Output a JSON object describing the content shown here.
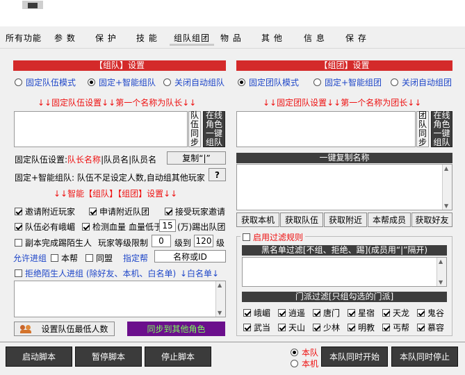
{
  "tabs": [
    "所有功能",
    "参 数",
    "保 护",
    "技 能",
    "组队组团",
    "物 品",
    "其 他",
    "信 息",
    "保 存"
  ],
  "left": {
    "header": "【组队】设置",
    "radios": [
      "固定队伍模式",
      "固定+智能组队",
      "关闭自动组队"
    ],
    "fixed_hint": "↓↓固定队伍设置↓↓第一个名称为队长↓↓",
    "side_btn": "队伍同步",
    "online_btn": "在线角色一键组队",
    "fixed_label": "固定队伍设置:",
    "fixed_fmt_red": "队长名称",
    "fixed_fmt_rest": "|队员名|队员名",
    "copy_btn": "复制“|”",
    "smart_label": "固定+智能组队: 队伍不足设定人数,自动组其他玩家",
    "help_btn": "?",
    "smart_hint": "↓↓智能【组队】【组团】设置↓↓",
    "cb_invite": "邀请附近玩家",
    "cb_apply": "申请附近队团",
    "cb_accept": "接受玩家邀请",
    "cb_emei": "队伍必有峨嵋",
    "cb_hp": "检测血量",
    "hp_label": "血量低于",
    "hp_value": "15",
    "hp_unit": "(万)踢出队团",
    "cb_kick": "副本完成踢陌生人",
    "level_label": "玩家等级限制",
    "level_min": "0",
    "level_mid": "级到",
    "level_max": "120",
    "level_unit": "级",
    "allow_label": "允许进组",
    "cb_guild": "本帮",
    "cb_ally": "同盟",
    "designated": "指定帮",
    "name_or_id": "名称或ID",
    "reject_label": "拒绝陌生人进组 (除好友、本机、白名单)",
    "whitelist": "↓白名单↓",
    "min_btn": "设置队伍最低人数",
    "sync_btn": "同步到其他角色"
  },
  "right": {
    "header": "【组团】设置",
    "radios": [
      "固定团队模式",
      "固定+智能组团",
      "关闭自动组团"
    ],
    "fixed_hint": "↓↓固定团队设置↓↓第一个名称为团长↓↓",
    "side_btn": "团队同步",
    "online_btn": "在线角色一键组队",
    "copy_header": "一键复制名称",
    "get_btns": [
      "获取本机",
      "获取队伍",
      "获取附近",
      "本帮成员",
      "获取好友"
    ],
    "filter_label": "启用过滤规则",
    "blacklist_header": "黑名单过滤[不组、拒绝、踢](成员用“|”隔开)",
    "sect_header": "门派过滤[只组勾选的门派]",
    "sects_row1": [
      "峨嵋",
      "逍遥",
      "唐门",
      "星宿",
      "天龙",
      "鬼谷"
    ],
    "sects_row2": [
      "武当",
      "天山",
      "少林",
      "明教",
      "丐帮",
      "慕容"
    ]
  },
  "bottom": {
    "start": "启动脚本",
    "pause": "暂停脚本",
    "stop": "停止脚本",
    "radio_team": "本队",
    "radio_local": "本机",
    "team_start": "本队同时开始",
    "team_stop": "本队同时停止"
  }
}
